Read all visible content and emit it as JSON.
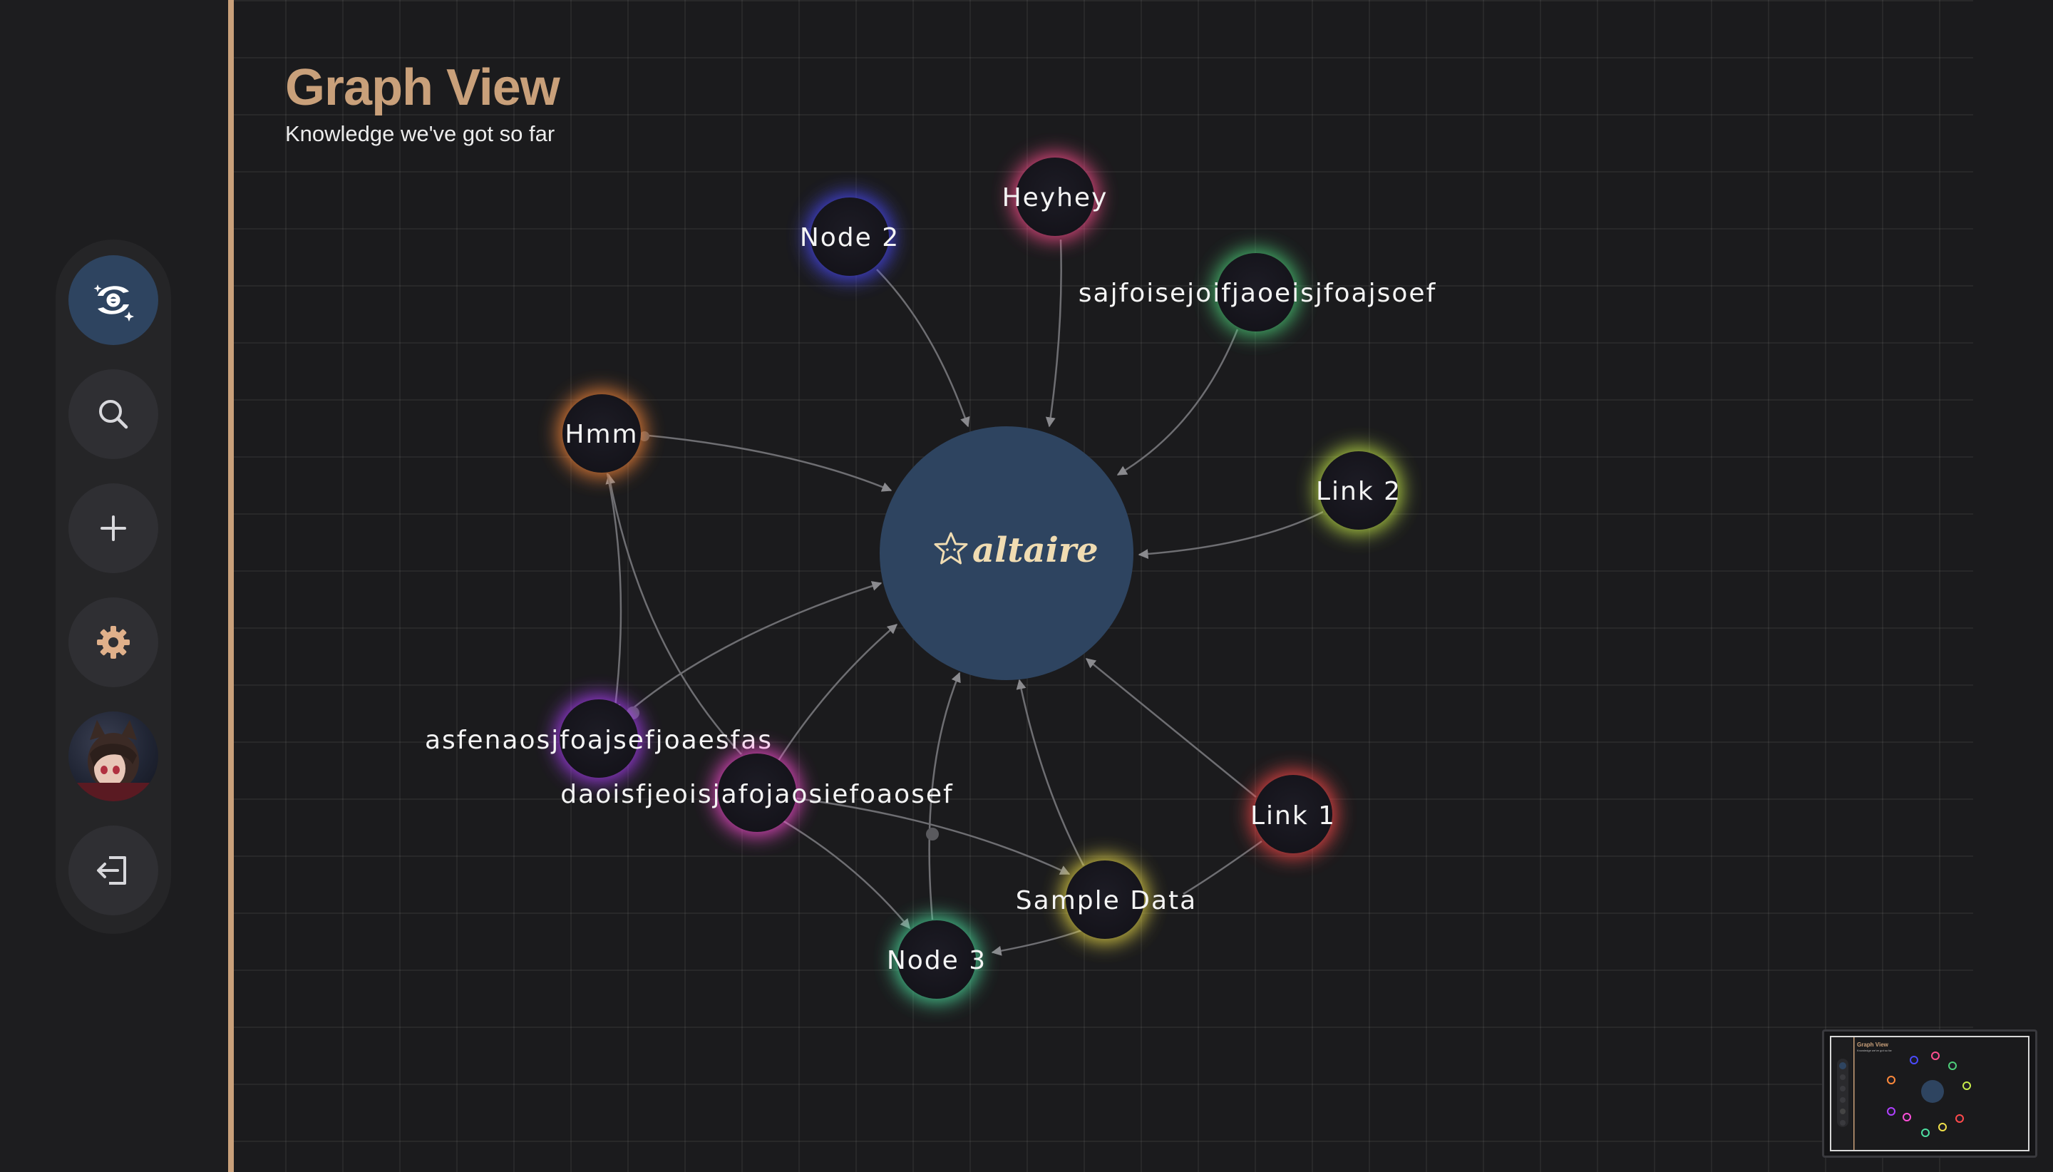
{
  "page": {
    "title": "Graph View",
    "subtitle": "Knowledge we've got so far"
  },
  "sidebar": {
    "items": [
      {
        "name": "home",
        "icon": "altaire-logo-icon",
        "active": true
      },
      {
        "name": "search",
        "icon": "search-icon"
      },
      {
        "name": "add",
        "icon": "plus-icon"
      },
      {
        "name": "settings",
        "icon": "gear-icon"
      },
      {
        "name": "profile",
        "icon": "avatar"
      },
      {
        "name": "logout",
        "icon": "logout-icon"
      }
    ]
  },
  "graph": {
    "center": {
      "label": "altaire",
      "icon": "star-face-icon",
      "color": "#2e4460"
    },
    "nodes": [
      {
        "id": "node2",
        "label": "Node 2",
        "glow": "#4b4bff"
      },
      {
        "id": "heyhey",
        "label": "Heyhey",
        "glow": "#ff4f8e"
      },
      {
        "id": "sajf",
        "label": "sajfoisejoifjaoeisjfoajsoef",
        "glow": "#4ecf79"
      },
      {
        "id": "hmm",
        "label": "Hmm",
        "glow": "#ff8a3a"
      },
      {
        "id": "link2",
        "label": "Link 2",
        "glow": "#c8ec4a"
      },
      {
        "id": "asfe",
        "label": "asfenaosjfoajsefjoaesfas",
        "glow": "#b040ff"
      },
      {
        "id": "daoi",
        "label": "daoisfjeoisjafojaosiefoaosef",
        "glow": "#ff4fd8"
      },
      {
        "id": "link1",
        "label": "Link 1",
        "glow": "#ff4a4a"
      },
      {
        "id": "sample",
        "label": "Sample Data",
        "glow": "#f0e04a"
      },
      {
        "id": "node3",
        "label": "Node 3",
        "glow": "#4ee0a0"
      }
    ]
  },
  "minimap": {
    "title": "Graph View",
    "subtitle": "Knowledge we've got so far"
  },
  "colors": {
    "accent": "#c9a07a",
    "background": "#1b1b1d",
    "center_node": "#2e4460",
    "edge": "#77777b"
  }
}
